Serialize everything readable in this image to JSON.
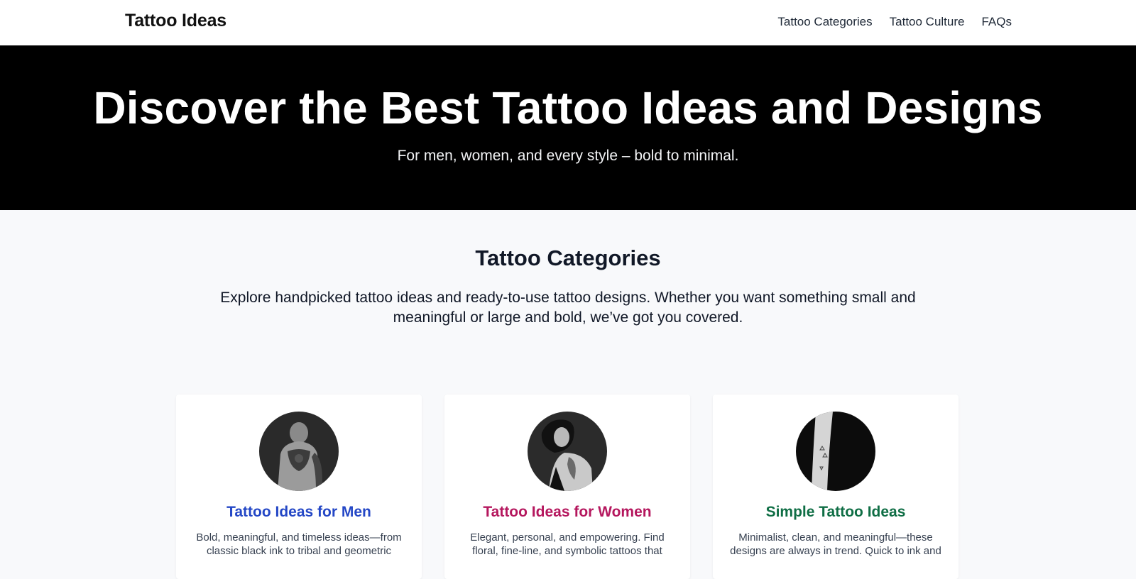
{
  "header": {
    "brand": "Tattoo Ideas",
    "nav": [
      {
        "label": "Tattoo Categories"
      },
      {
        "label": "Tattoo Culture"
      },
      {
        "label": "FAQs"
      }
    ]
  },
  "hero": {
    "title": "Discover the Best Tattoo Ideas and Designs",
    "subtitle": "For men, women, and every style – bold to minimal."
  },
  "categories": {
    "title": "Tattoo Categories",
    "intro": "Explore handpicked tattoo ideas and ready-to-use tattoo designs. Whether you want something small and meaningful or large and bold, we’ve got you covered.",
    "cards": [
      {
        "title": "Tattoo Ideas for Men",
        "color": "#2447c6",
        "image": "man-back-tattoo-photo",
        "description": "Bold, meaningful, and timeless ideas—from classic black ink to tribal and geometric"
      },
      {
        "title": "Tattoo Ideas for Women",
        "color": "#b5175e",
        "image": "woman-shoulder-tattoo-photo",
        "description": "Elegant, personal, and empowering. Find floral, fine-line, and symbolic tattoos that"
      },
      {
        "title": "Simple Tattoo Ideas",
        "color": "#0f6e45",
        "image": "forearm-minimal-tattoo-photo",
        "description": "Minimalist, clean, and meaningful—these designs are always in trend. Quick to ink and"
      }
    ]
  }
}
